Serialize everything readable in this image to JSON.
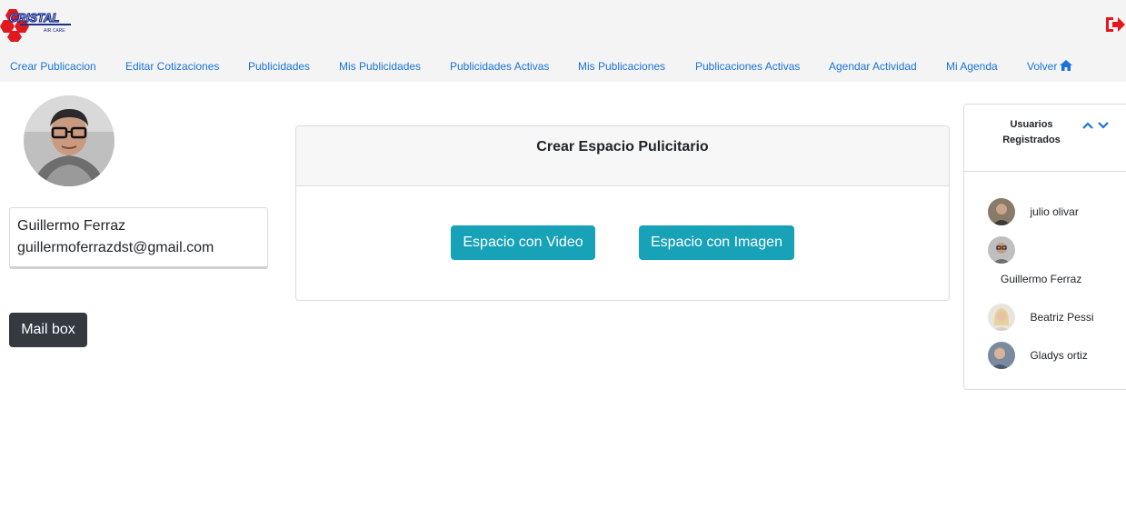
{
  "brand": {
    "name": "CRISTAL",
    "sub": "AIR CARE"
  },
  "nav": [
    "Crear Publicacion",
    "Editar Cotizaciones",
    "Publicidades",
    "Mis Publicidades",
    "Publicidades Activas",
    "Mis Publicaciones",
    "Publicaciones Activas",
    "Agendar Actividad",
    "Mi Agenda",
    "Volver"
  ],
  "profile": {
    "name": "Guillermo Ferraz",
    "email": "guillermoferrazdst@gmail.com"
  },
  "mailbox_label": "Mail box",
  "card": {
    "title": "Crear Espacio Pulicitario",
    "video_button": "Espacio con Video",
    "image_button": "Espacio con Imagen"
  },
  "users_panel": {
    "title": "Usuarios Registrados",
    "users": [
      {
        "name": "julio olivar"
      },
      {
        "name": "Guillermo Ferraz"
      },
      {
        "name": "Beatriz Pessi"
      },
      {
        "name": "Gladys ortiz"
      }
    ]
  },
  "colors": {
    "link": "#1a73d9",
    "teal": "#17a2b8",
    "dark": "#343a40",
    "logout": "#e8141b",
    "brand_red": "#e0191f"
  },
  "icons": {
    "logout": "sign-out-icon",
    "home": "home-icon",
    "up": "chevron-up-icon",
    "down": "chevron-down-icon"
  }
}
